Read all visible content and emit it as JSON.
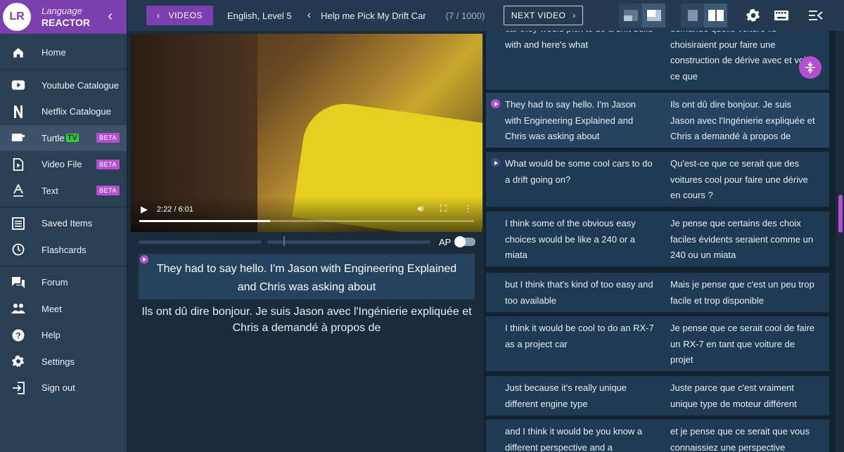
{
  "brand": {
    "line1": "Language",
    "line2": "REACTOR",
    "logo_text": "LR"
  },
  "sidebar": {
    "items": [
      {
        "label": "Home",
        "icon": "home-icon"
      },
      {
        "label": "Youtube Catalogue",
        "icon": "youtube-icon"
      },
      {
        "label": "Netflix Catalogue",
        "icon": "netflix-icon"
      },
      {
        "label": "Turtle",
        "tv": "TV",
        "badge": "BETA",
        "icon": "tv-icon",
        "active": true
      },
      {
        "label": "Video File",
        "badge": "BETA",
        "icon": "video-file-icon"
      },
      {
        "label": "Text",
        "badge": "BETA",
        "icon": "text-icon"
      },
      {
        "label": "Saved Items",
        "icon": "list-icon"
      },
      {
        "label": "Flashcards",
        "icon": "clock-icon"
      },
      {
        "label": "Forum",
        "icon": "forum-icon"
      },
      {
        "label": "Meet",
        "icon": "people-icon"
      },
      {
        "label": "Help",
        "icon": "help-icon"
      },
      {
        "label": "Settings",
        "icon": "gear-icon"
      },
      {
        "label": "Sign out",
        "icon": "sign-out-icon"
      }
    ]
  },
  "topbar": {
    "videos_label": "VIDEOS",
    "level": "English, Level 5",
    "title": "Help me Pick My Drift Car",
    "count": "(7 / 1000)",
    "next_label": "NEXT VIDEO"
  },
  "player": {
    "time": "2:22 / 6:01",
    "progress": 0.39
  },
  "subtitle": {
    "ap_label": "AP",
    "current": "They had to say hello. I'm Jason with Engineering Explained and Chris was asking about",
    "translation": "Ils ont dû dire bonjour. Je suis Jason avec l'Ingénierie expliquée et Chris a demandé à propos de"
  },
  "transcript": [
    {
      "en": "car they would pick to do a drift build with and here's what",
      "fr": "demande quelle voiture ils choisiraient pour faire une construction de dérive avec et voici ce que",
      "play": false
    },
    {
      "en": "They had to say hello. I'm Jason with Engineering Explained and Chris was asking about",
      "fr": "Ils ont dû dire bonjour. Je suis Jason avec l'Ingénierie expliquée et Chris a demandé à propos de",
      "play": true,
      "active": true
    },
    {
      "en": "What would be some cool cars to do a drift going on?",
      "fr": "Qu'est-ce que ce serait que des voitures cool pour faire une dérive en cours ?",
      "play": "dim"
    },
    {
      "en": "I think some of the obvious easy choices would be like a 240 or a miata",
      "fr": "Je pense que certains des choix faciles évidents seraient comme un 240 ou un miata",
      "play": false
    },
    {
      "en": "but I think that's kind of too easy and too available",
      "fr": "Mais je pense que c'est un peu trop facile et trop disponible",
      "play": false
    },
    {
      "en": "I think it would be cool to do an RX-7 as a project car",
      "fr": "Je pense que ce serait cool de faire un RX-7 en tant que voiture de projet",
      "play": false
    },
    {
      "en": "Just because it's really unique different engine type",
      "fr": "Juste parce que c'est vraiment unique type de moteur différent",
      "play": false
    },
    {
      "en": "and I think it would be you know a different perspective and a",
      "fr": "et je pense que ce serait que vous connaissiez une perspective",
      "play": false
    }
  ]
}
